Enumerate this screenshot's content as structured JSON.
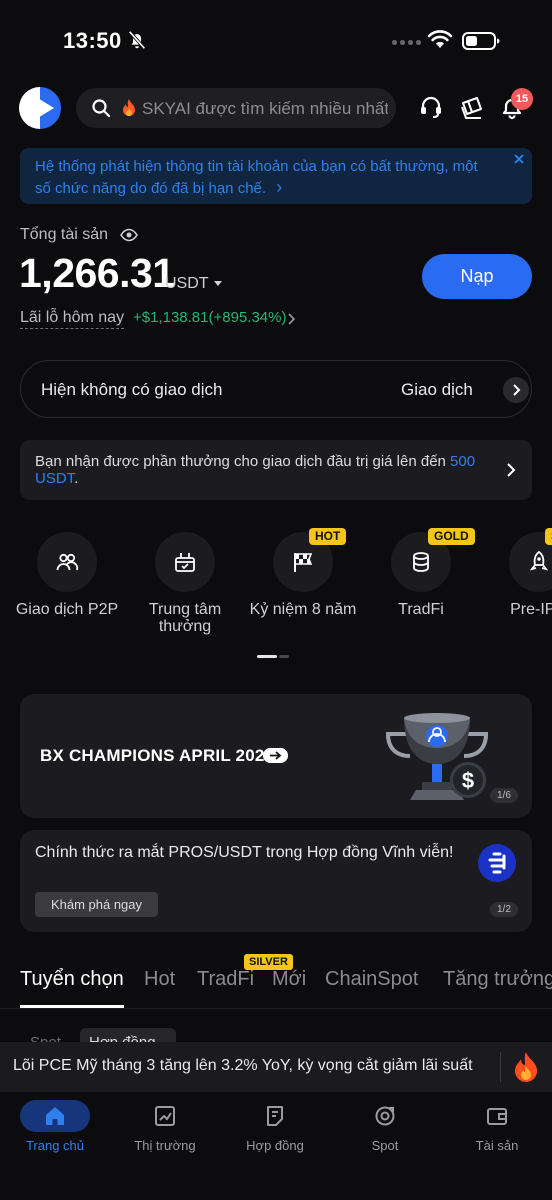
{
  "status_bar": {
    "time": "13:50"
  },
  "header": {
    "search_placeholder": "SKYAI được tìm kiếm nhiều nhất",
    "notification_count": "15"
  },
  "alert": {
    "text": "Hệ thống phát hiện thông tin tài khoản của bạn có bất thường, một số chức năng do đó đã bị hạn chế.",
    "link_arrow": "›"
  },
  "assets": {
    "label": "Tổng tài sản",
    "value": "1,266.31",
    "unit": "USDT",
    "deposit_label": "Nạp",
    "pnl_label": "Lãi lỗ hôm nay",
    "pnl_value": "+$1,138.81(+895.34%)"
  },
  "transactions": {
    "empty_text": "Hiện không có giao dịch",
    "action_label": "Giao dịch"
  },
  "reward": {
    "text": "Bạn nhận được phần thưởng cho giao dịch đầu trị giá lên đến",
    "highlight": "500 USDT",
    "suffix": "."
  },
  "shortcuts": [
    {
      "label": "Giao dịch P2P",
      "icon": "users-icon",
      "tag": ""
    },
    {
      "label": "Trung tâm thưởng",
      "icon": "gift-calendar-icon",
      "tag": ""
    },
    {
      "label": "Kỷ niệm 8 năm",
      "icon": "checkered-flag-icon",
      "tag": "HOT"
    },
    {
      "label": "TradFi",
      "icon": "coin-stack-icon",
      "tag": "GOLD"
    },
    {
      "label": "Pre-IPO",
      "icon": "rocket-icon",
      "tag": "S"
    }
  ],
  "banner": {
    "title": "BX CHAMPIONS APRIL 2026",
    "counter": "1/6"
  },
  "news": {
    "text": "Chính thức ra mắt PROS/USDT trong Hợp đồng Vĩnh viễn!",
    "button": "Khám phá ngay",
    "counter": "1/2"
  },
  "tabs": [
    {
      "label": "Tuyển chọn",
      "active": true
    },
    {
      "label": "Hot"
    },
    {
      "label": "TradFi",
      "tag": "SILVER"
    },
    {
      "label": "Mới"
    },
    {
      "label": "ChainSpot"
    },
    {
      "label": "Tăng trưởng"
    }
  ],
  "subtabs": [
    "Spot",
    "Hợp đồng"
  ],
  "ticker": {
    "text": "Lõi PCE Mỹ tháng 3 tăng lên 3.2% YoY, kỳ vọng cắt giảm lãi suất"
  },
  "bottom_nav": [
    {
      "label": "Trang chủ",
      "icon": "home-icon",
      "active": true
    },
    {
      "label": "Thị trường",
      "icon": "chart-icon"
    },
    {
      "label": "Hợp đồng",
      "icon": "contract-icon"
    },
    {
      "label": "Spot",
      "icon": "spot-icon"
    },
    {
      "label": "Tài sản",
      "icon": "wallet-icon"
    }
  ],
  "colors": {
    "accent": "#2a6bf2",
    "positive": "#22b677",
    "tag": "#f5c518",
    "badge": "#f05a5a",
    "background": "#0c0c0e"
  }
}
